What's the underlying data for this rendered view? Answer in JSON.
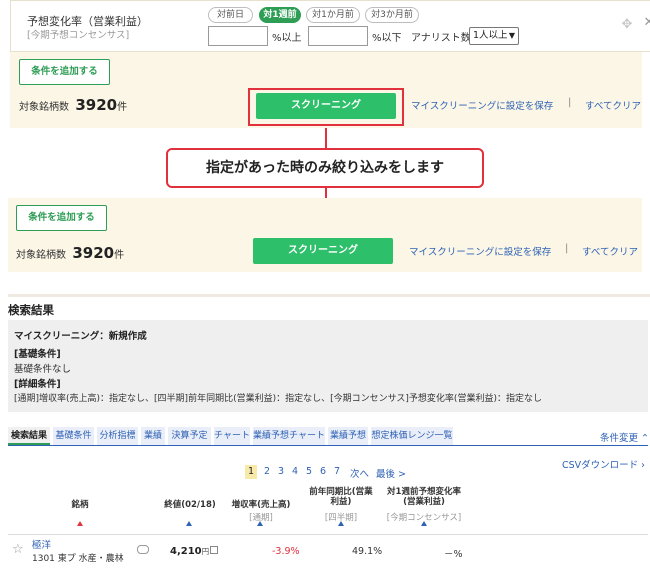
{
  "condition": {
    "label": "予想変化率（営業利益）",
    "sublabel": "[今期予想コンセンサス]",
    "periods": [
      "対前日",
      "対1週前",
      "対1か月前",
      "対3か月前"
    ],
    "active_period": "対1週前",
    "unit_min": "%以上",
    "unit_max": "%以下",
    "analyst_label": "アナリスト数",
    "analyst_select": "1人以上"
  },
  "panel1": {
    "add_condition": "条件を追加する",
    "count_label": "対象銘柄数",
    "count_value": "3920",
    "count_unit": "件",
    "screening": "スクリーニング",
    "save_link": "マイスクリーニングに設定を保存",
    "separator": "|",
    "clear_link": "すべてクリア"
  },
  "callout": "指定があった時のみ絞り込みをします",
  "panel2": {
    "add_condition": "条件を追加する",
    "count_label": "対象銘柄数",
    "count_value": "3920",
    "count_unit": "件",
    "screening": "スクリーニング",
    "save_link": "マイスクリーニングに設定を保存",
    "separator": "|",
    "clear_link": "すべてクリア"
  },
  "results": {
    "title": "検索結果",
    "summary": {
      "name": "マイスクリーニング：新規作成",
      "basic_header": "[基礎条件]",
      "basic_text": "基礎条件なし",
      "detail_header": "[詳細条件]",
      "detail_text": "[通期]増収率(売上高)：指定なし、[四半期]前年同期比(営業利益)：指定なし、[今期コンセンサス]予想変化率(営業利益)：指定なし"
    },
    "tabs": [
      "検索結果",
      "基礎条件",
      "分析指標",
      "業績",
      "決算予定",
      "チャート",
      "業績予想チャート",
      "業績予想",
      "想定株価レンジ一覧"
    ],
    "active_tab": "検索結果",
    "condition_change": "条件変更 ⌃",
    "pages": [
      "1",
      "2",
      "3",
      "4",
      "5",
      "6",
      "7"
    ],
    "next": "次へ",
    "last": "最後 >",
    "csv": "CSVダウンロード ›",
    "columns": {
      "name": "銘柄",
      "price": "終値(02/18)",
      "growth": "増収率(売上高)",
      "growth_sub": "[通期]",
      "yoy": "前年同期比(営業利益)",
      "yoy_sub": "[四半期]",
      "change": "対1週前予想変化率(営業利益)",
      "change_sub": "[今期コンセンサス]"
    },
    "row": {
      "name": "極洋",
      "info": "1301 東プ 水産・農林",
      "price": "4,210",
      "price_unit": "円",
      "growth": "-3.9%",
      "yoy": "49.1%",
      "change": "－%"
    }
  }
}
